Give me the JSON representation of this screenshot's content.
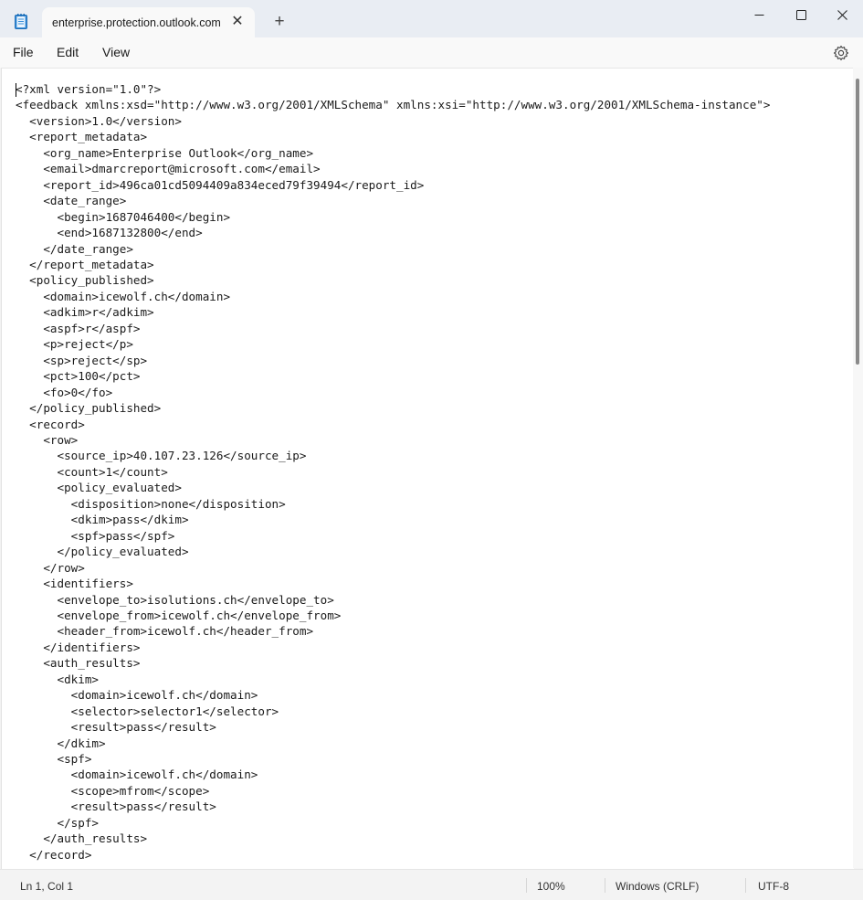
{
  "tab": {
    "title": "enterprise.protection.outlook.com"
  },
  "menu": {
    "file": "File",
    "edit": "Edit",
    "view": "View"
  },
  "editor": {
    "lines": [
      "<?xml version=\"1.0\"?>",
      "<feedback xmlns:xsd=\"http://www.w3.org/2001/XMLSchema\" xmlns:xsi=\"http://www.w3.org/2001/XMLSchema-instance\">",
      "  <version>1.0</version>",
      "  <report_metadata>",
      "    <org_name>Enterprise Outlook</org_name>",
      "    <email>dmarcreport@microsoft.com</email>",
      "    <report_id>496ca01cd5094409a834eced79f39494</report_id>",
      "    <date_range>",
      "      <begin>1687046400</begin>",
      "      <end>1687132800</end>",
      "    </date_range>",
      "  </report_metadata>",
      "  <policy_published>",
      "    <domain>icewolf.ch</domain>",
      "    <adkim>r</adkim>",
      "    <aspf>r</aspf>",
      "    <p>reject</p>",
      "    <sp>reject</sp>",
      "    <pct>100</pct>",
      "    <fo>0</fo>",
      "  </policy_published>",
      "  <record>",
      "    <row>",
      "      <source_ip>40.107.23.126</source_ip>",
      "      <count>1</count>",
      "      <policy_evaluated>",
      "        <disposition>none</disposition>",
      "        <dkim>pass</dkim>",
      "        <spf>pass</spf>",
      "      </policy_evaluated>",
      "    </row>",
      "    <identifiers>",
      "      <envelope_to>isolutions.ch</envelope_to>",
      "      <envelope_from>icewolf.ch</envelope_from>",
      "      <header_from>icewolf.ch</header_from>",
      "    </identifiers>",
      "    <auth_results>",
      "      <dkim>",
      "        <domain>icewolf.ch</domain>",
      "        <selector>selector1</selector>",
      "        <result>pass</result>",
      "      </dkim>",
      "      <spf>",
      "        <domain>icewolf.ch</domain>",
      "        <scope>mfrom</scope>",
      "        <result>pass</result>",
      "      </spf>",
      "    </auth_results>",
      "  </record>"
    ]
  },
  "status": {
    "position": "Ln 1, Col 1",
    "zoom": "100%",
    "line_ending": "Windows (CRLF)",
    "encoding": "UTF-8"
  },
  "icons": {
    "app": "notepad-icon",
    "close_tab": "close-icon",
    "new_tab": "plus-icon",
    "minimize": "minimize-icon",
    "maximize": "maximize-icon",
    "close": "close-icon",
    "settings": "gear-icon"
  },
  "colors": {
    "titlebar": "#e9edf3",
    "editor_bg": "#ffffff",
    "accent": "#0067c0"
  }
}
